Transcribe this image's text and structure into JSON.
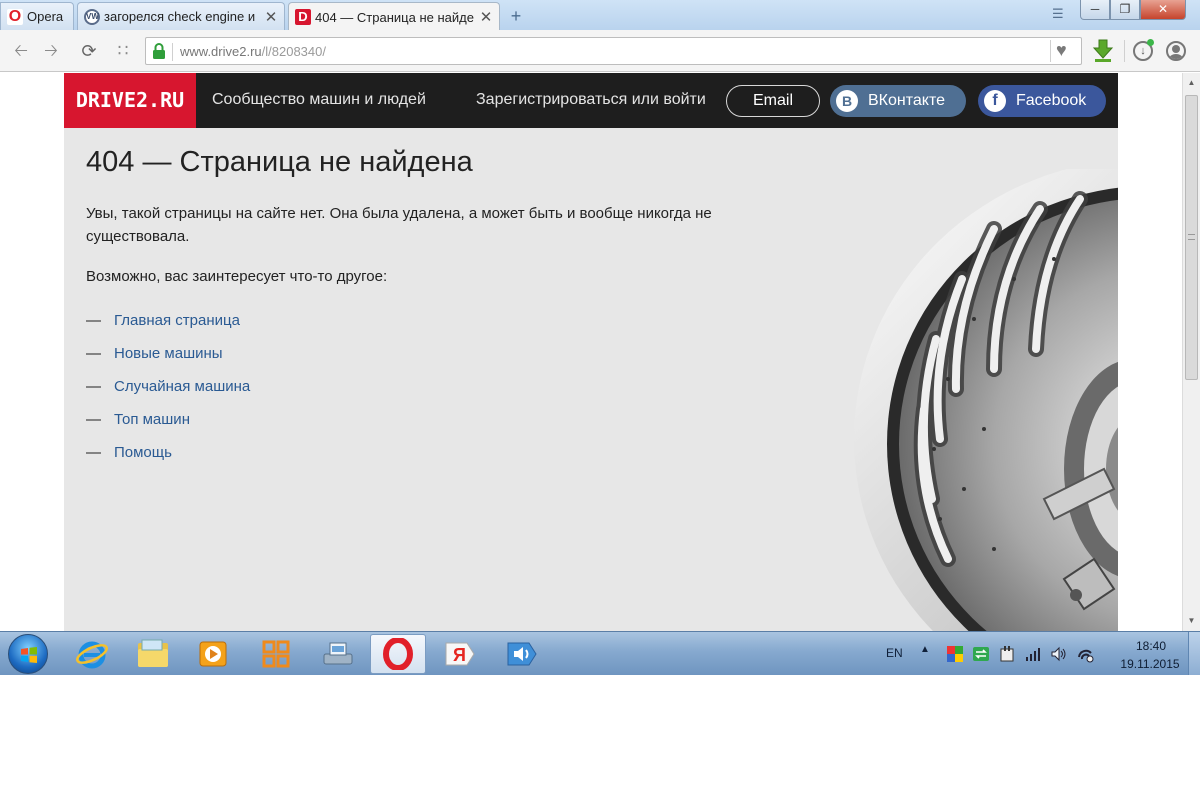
{
  "browser": {
    "tabs": [
      {
        "label": "Opera"
      },
      {
        "label": "загорелся check engine и"
      },
      {
        "label": "404 — Страница не найде"
      }
    ],
    "url_host": "www.drive2.ru",
    "url_path": "/l/8208340/",
    "new_tab_label": "+",
    "close_label": "✕"
  },
  "site": {
    "logo": "DRIVE2.RU",
    "tagline": "Сообщество машин и людей",
    "login": "Зарегистрироваться или войти",
    "email": "Email",
    "vk": "ВКонтакте",
    "facebook": "Facebook"
  },
  "content": {
    "title": "404 — Страница не найдена",
    "lead": "Увы, такой страницы на сайте нет. Она была удалена, а может быть и вообще никогда не существовала.",
    "suggest": "Возможно, вас заинтересует что-то другое:",
    "dash": "—",
    "links": [
      "Главная страница",
      "Новые машины",
      "Случайная машина",
      "Топ машин",
      "Помощь"
    ]
  },
  "taskbar": {
    "lang": "EN",
    "time": "18:40",
    "date": "19.11.2015"
  },
  "colors": {
    "brand_red": "#d7162f",
    "header_black": "#1e1e1e",
    "link_blue": "#2a5a93",
    "vk_blue": "#4f6f93",
    "fb_blue": "#3b579c"
  },
  "icons": {
    "nav": [
      "back-arrow-icon",
      "forward-arrow-icon",
      "reload-icon",
      "speed-dial-icon",
      "lock-icon",
      "heart-icon",
      "download-icon",
      "update-icon",
      "account-icon"
    ],
    "taskbar": [
      "windows-start-icon",
      "internet-explorer-icon",
      "file-explorer-icon",
      "media-player-icon",
      "office-icon",
      "scanner-icon",
      "opera-icon",
      "yandex-icon",
      "speaker-app-icon"
    ]
  }
}
